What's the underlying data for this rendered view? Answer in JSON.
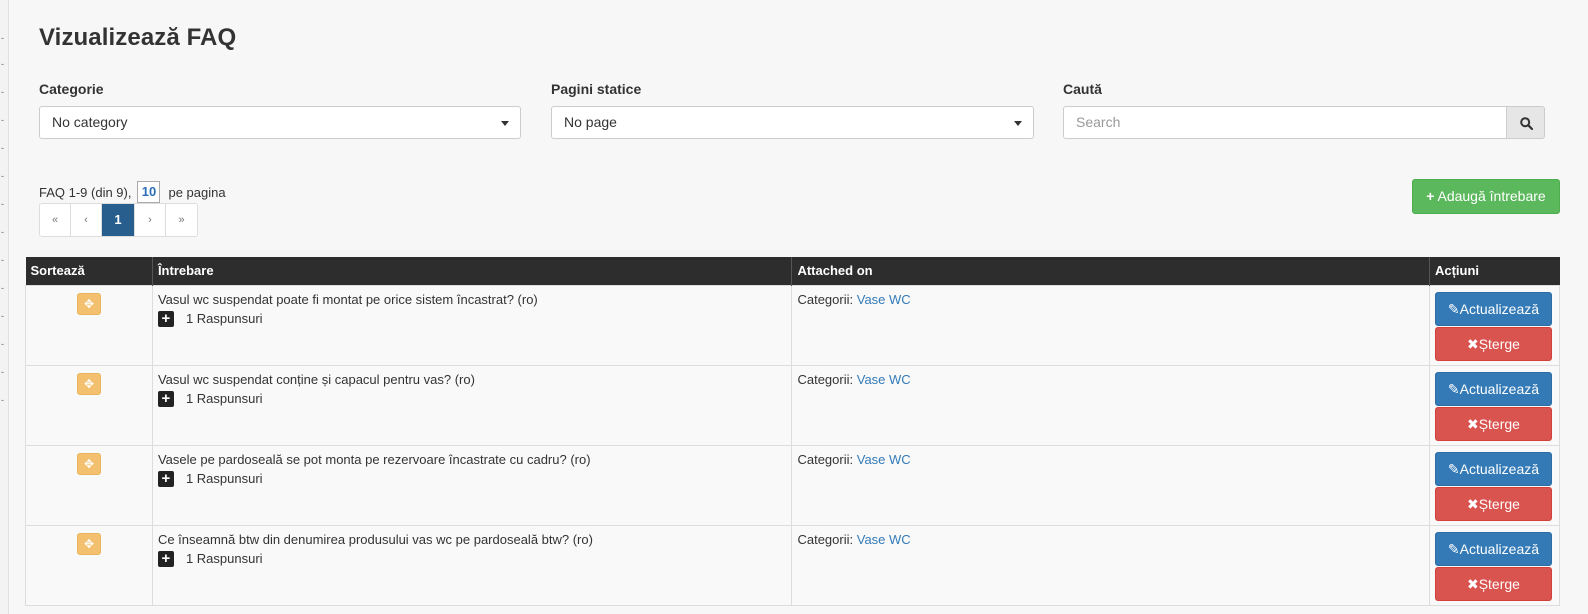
{
  "page": {
    "title": "Vizualizează FAQ"
  },
  "filters": {
    "category": {
      "label": "Categorie",
      "value": "No category"
    },
    "static_pages": {
      "label": "Pagini statice",
      "value": "No page"
    },
    "search": {
      "label": "Caută",
      "placeholder": "Search"
    }
  },
  "pagination": {
    "summary": "FAQ 1-9 (din 9),",
    "per_page_value": "10",
    "per_page_label": "pe pagina",
    "first": "«",
    "prev": "‹",
    "current": "1",
    "next": "›",
    "last": "»"
  },
  "toolbar": {
    "add_label": "Adaugă întrebare",
    "add_icon": "+"
  },
  "table": {
    "headers": [
      "Sortează",
      "Întrebare",
      "Attached on",
      "Acțiuni"
    ],
    "rows": [
      {
        "question": "Vasul wc suspendat poate fi montat pe orice sistem încastrat? (ro)",
        "answers": "1 Raspunsuri",
        "attached_prefix": "Categorii:",
        "attached_link": "Vase WC"
      },
      {
        "question": "Vasul wc suspendat conține și capacul pentru vas? (ro)",
        "answers": "1 Raspunsuri",
        "attached_prefix": "Categorii:",
        "attached_link": "Vase WC"
      },
      {
        "question": "Vasele pe pardoseală se pot monta pe rezervoare încastrate cu cadru? (ro)",
        "answers": "1 Raspunsuri",
        "attached_prefix": "Categorii:",
        "attached_link": "Vase WC"
      },
      {
        "question": "Ce înseamnă btw din denumirea produsului vas wc pe pardoseală btw? (ro)",
        "answers": "1 Raspunsuri",
        "attached_prefix": "Categorii:",
        "attached_link": "Vase WC"
      }
    ],
    "update_label": "Actualizează",
    "delete_label": "Șterge"
  },
  "icons": {
    "search": "search-icon",
    "plus": "plus-icon",
    "move": "move-icon",
    "expand": "expand-icon",
    "edit": "edit-icon",
    "delete": "times-icon"
  },
  "colors": {
    "header_bg": "#2d2d2d",
    "primary": "#337ab7",
    "danger": "#d9534f",
    "success": "#5cb85c",
    "sort_handle": "#f2c06e",
    "pager_active": "#285e8e"
  }
}
